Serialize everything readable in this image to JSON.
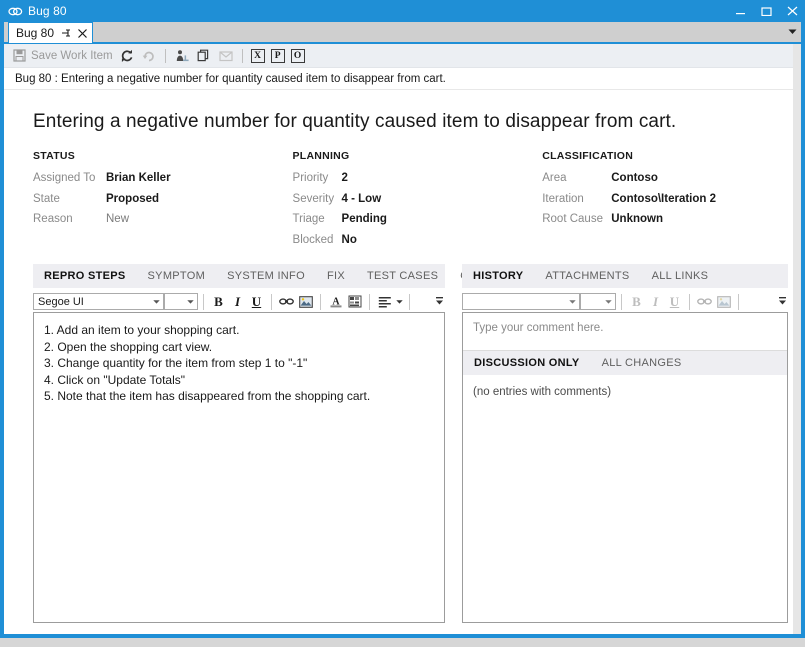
{
  "window": {
    "title": "Bug 80",
    "app_icon": "link-chain-icon",
    "buttons": {
      "minimize": "minimize-icon",
      "maximize": "maximize-icon",
      "close": "close-icon"
    }
  },
  "tabstrip": {
    "tab_label": "Bug 80",
    "pin_icon": "pin-icon",
    "close_icon": "close-icon",
    "dropdown_icon": "chevron-down-icon"
  },
  "toolbar": {
    "save_label": "Save Work Item",
    "save_icon": "save-disk-icon",
    "items": [
      {
        "name": "refresh-icon",
        "icon": "refresh-icon",
        "enabled": true
      },
      {
        "name": "undo-icon",
        "icon": "undo-arrow-icon",
        "enabled": false
      },
      {
        "name": "link-to-icon",
        "icon": "link-person-icon",
        "enabled": true
      },
      {
        "name": "copy-icon",
        "icon": "copy-icon",
        "enabled": true
      },
      {
        "name": "email-icon",
        "icon": "email-icon",
        "enabled": false
      }
    ],
    "boxed": [
      "X",
      "P",
      "O"
    ]
  },
  "infobar": {
    "text": "Bug 80 : Entering a negative number for quantity caused item to disappear from cart."
  },
  "form": {
    "title": "Entering a negative number for quantity caused item to disappear from cart.",
    "groups": [
      {
        "heading": "STATUS",
        "fields": [
          {
            "label": "Assigned To",
            "value": "Brian Keller",
            "dim": false
          },
          {
            "label": "State",
            "value": "Proposed",
            "dim": false
          },
          {
            "label": "Reason",
            "value": "New",
            "dim": true
          }
        ]
      },
      {
        "heading": "PLANNING",
        "fields": [
          {
            "label": "Priority",
            "value": "2",
            "dim": false
          },
          {
            "label": "Severity",
            "value": "4 - Low",
            "dim": false
          },
          {
            "label": "Triage",
            "value": "Pending",
            "dim": false
          },
          {
            "label": "Blocked",
            "value": "No",
            "dim": false
          }
        ]
      },
      {
        "heading": "CLASSIFICATION",
        "fields": [
          {
            "label": "Area",
            "value": "Contoso",
            "dim": false
          },
          {
            "label": "Iteration",
            "value": "Contoso\\Iteration 2",
            "dim": false
          },
          {
            "label": "Root Cause",
            "value": "Unknown",
            "dim": false
          }
        ]
      }
    ]
  },
  "left_pane": {
    "tabs": [
      {
        "label": "REPRO STEPS",
        "active": true
      },
      {
        "label": "SYMPTOM",
        "active": false
      },
      {
        "label": "SYSTEM INFO",
        "active": false
      },
      {
        "label": "FIX",
        "active": false
      },
      {
        "label": "TEST CASES",
        "active": false
      },
      {
        "label": "OTHER",
        "active": false
      }
    ],
    "editor_toolbar": {
      "font_name": "Segoe UI",
      "font_size": "",
      "bold": "B",
      "italic": "I",
      "underline": "U",
      "link_icon": "link-icon",
      "image_icon": "image-icon",
      "font_color_icon": "font-color-icon",
      "highlight_icon": "highlight-icon",
      "align_icon": "align-left-icon",
      "overflow_icon": "toolbar-overflow-icon"
    },
    "repro_steps": [
      "1. Add an item to your shopping cart.",
      "2. Open the shopping cart view.",
      "3. Change quantity for the item from step 1 to \"-1\"",
      "4. Click on \"Update Totals\"",
      "5. Note that the item has disappeared from the shopping cart."
    ]
  },
  "right_pane": {
    "tabs": [
      {
        "label": "HISTORY",
        "active": true
      },
      {
        "label": "ATTACHMENTS",
        "active": false
      },
      {
        "label": "ALL LINKS",
        "active": false
      }
    ],
    "editor_toolbar": {
      "font_name": "",
      "font_size": "",
      "bold": "B",
      "italic": "I",
      "underline": "U",
      "link_icon": "link-icon",
      "image_icon": "image-icon",
      "overflow_icon": "toolbar-overflow-icon"
    },
    "comment_placeholder": "Type your comment here.",
    "discussion_tabs": [
      {
        "label": "DISCUSSION ONLY",
        "active": true
      },
      {
        "label": "ALL CHANGES",
        "active": false
      }
    ],
    "empty_message": "(no entries with comments)"
  },
  "colors": {
    "accent": "#1f8fd6",
    "toolbar_bg": "#eceff3",
    "tabbar_bg": "#eeeef2",
    "text": "#1a1a1a",
    "muted": "#8a8a8a"
  }
}
